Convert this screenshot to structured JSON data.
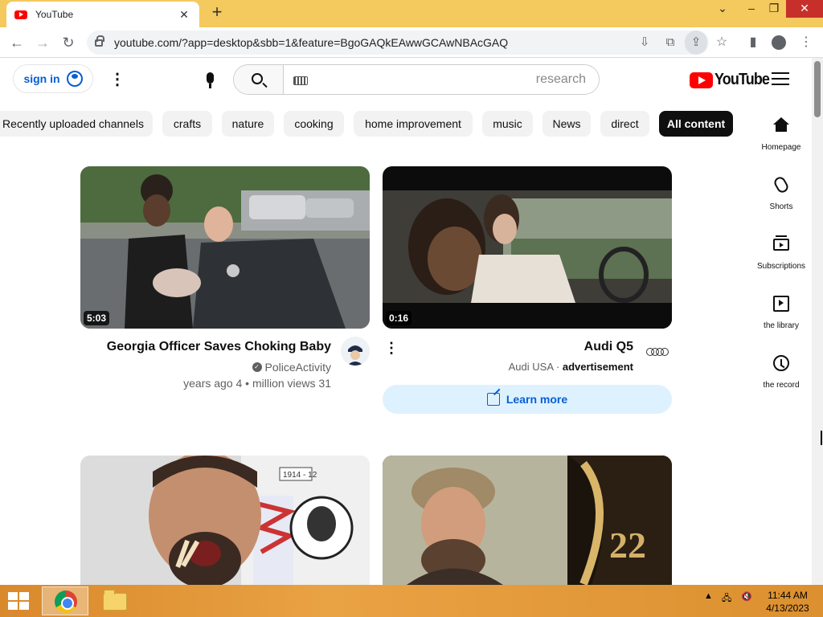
{
  "browser": {
    "tab_title": "YouTube",
    "url": "youtube.com/?app=desktop&sbb=1&feature=BgoGAQkEAwwGCAwNBAcGAQ"
  },
  "header": {
    "sign_in_label": "sign in",
    "search_placeholder": "research",
    "logo_text": "YouTube"
  },
  "chips": [
    "Recently uploaded channels",
    "crafts",
    "nature",
    "cooking",
    "home improvement",
    "music",
    "News",
    "direct",
    "All content"
  ],
  "active_chip": "All content",
  "guide": [
    {
      "label": "Homepage",
      "icon": "home-icon"
    },
    {
      "label": "Shorts",
      "icon": "shorts-icon"
    },
    {
      "label": "Subscriptions",
      "icon": "subscriptions-icon"
    },
    {
      "label": "the library",
      "icon": "library-icon"
    },
    {
      "label": "the record",
      "icon": "history-icon"
    }
  ],
  "videos": [
    {
      "title": "Georgia Officer Saves Choking Baby",
      "channel": "PoliceActivity",
      "meta": "years ago 4 • million views 31",
      "duration": "5:03",
      "verified": true
    }
  ],
  "ad": {
    "title": "Audi Q5",
    "advertiser": "Audi USA",
    "tag": "advertisement",
    "duration": "0:16",
    "cta": "Learn more"
  },
  "second_row": {
    "thumb_badge_number": "22",
    "poster_text_1": "1914 - 12"
  },
  "taskbar": {
    "time": "11:44 AM",
    "date": "4/13/2023"
  },
  "colors": {
    "tabbar": "#f4c95d",
    "yt_red": "#ff0000",
    "link_blue": "#065fd4",
    "taskbar": "#e9a244"
  }
}
